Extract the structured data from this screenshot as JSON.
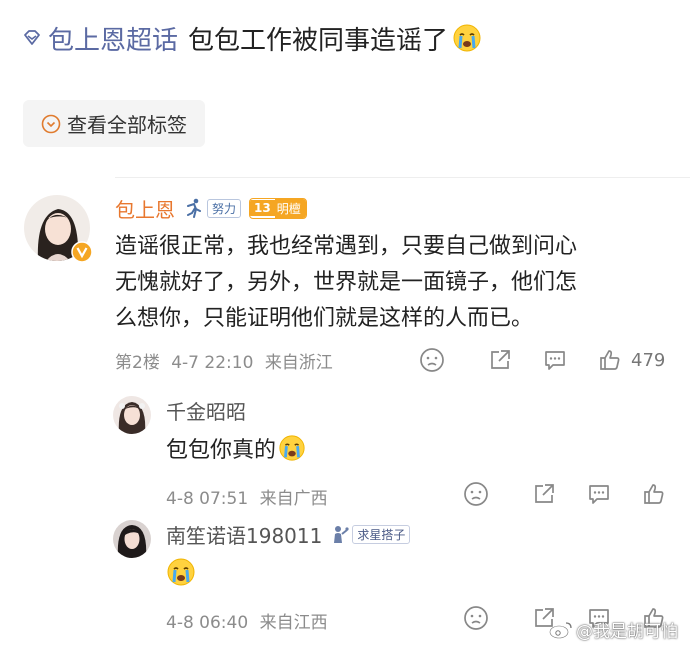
{
  "header": {
    "topic_label": "包上恩超话",
    "post_title": "包包工作被同事造谣了",
    "title_emoji": "crying-face-emoji"
  },
  "tag_button": {
    "label": "查看全部标签",
    "icon": "chevron-down-circle-icon"
  },
  "comments": [
    {
      "username": "包上恩",
      "badge_effort": "努力",
      "badge_level": "13",
      "badge_star": "明檀",
      "verified_icon": "v-verified-icon",
      "text_lines": [
        "造谣很正常，我也经常遇到，只要自己做到问心",
        "无愧就好了，另外，世界就是一面镜子，他们怎",
        "么想你，只能证明他们就是这样的人而已。"
      ],
      "floor": "第2楼",
      "date": "4-7 22:10",
      "location": "来自浙江",
      "likes": "479"
    },
    {
      "username": "千金昭昭",
      "text": "包包你真的",
      "emoji": "crying-face-emoji",
      "date": "4-8 07:51",
      "location": "来自广西"
    },
    {
      "username": "南笙诺语198011",
      "badge": "求星搭子",
      "emoji": "crying-face-emoji",
      "date": "4-8 06:40",
      "location": "来自江西"
    }
  ],
  "watermark": "@我是胡可怕",
  "colors": {
    "topic_link": "#5b6aa3",
    "username_highlight": "#e8772e",
    "meta_text": "#8c8c8c",
    "badge_level_bg": "#f5a623",
    "badge_blue": "#4a6fa5"
  }
}
